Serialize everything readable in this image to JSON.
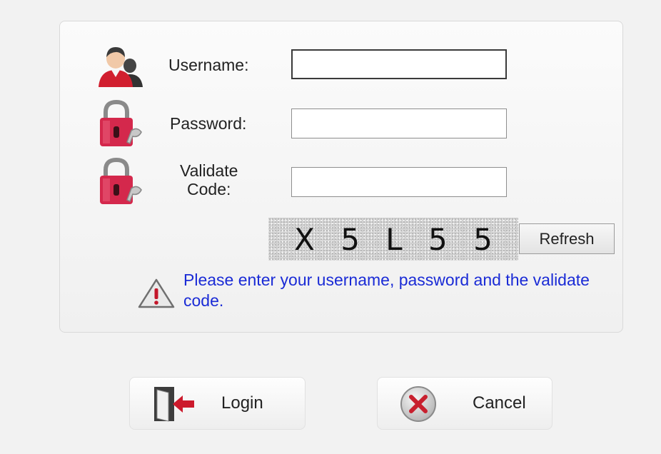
{
  "form": {
    "username_label": "Username:",
    "password_label": "Password:",
    "validate_label_line1": "Validate",
    "validate_label_line2": "Code:",
    "username_value": "",
    "password_value": "",
    "validate_value": ""
  },
  "captcha": {
    "characters": [
      "X",
      "5",
      "L",
      "5",
      "5"
    ],
    "refresh_label": "Refresh"
  },
  "message": {
    "text": "Please enter your username, password and the validate code.",
    "color": "#1a2bd6"
  },
  "actions": {
    "login_label": "Login",
    "cancel_label": "Cancel"
  },
  "icons": {
    "username": "user-group-icon",
    "password": "lock-key-icon",
    "validate": "lock-key-icon",
    "message": "warning-icon",
    "login": "door-enter-icon",
    "cancel": "cancel-x-icon"
  },
  "colors": {
    "accent_red": "#c41e3a",
    "message_blue": "#1a2bd6"
  }
}
